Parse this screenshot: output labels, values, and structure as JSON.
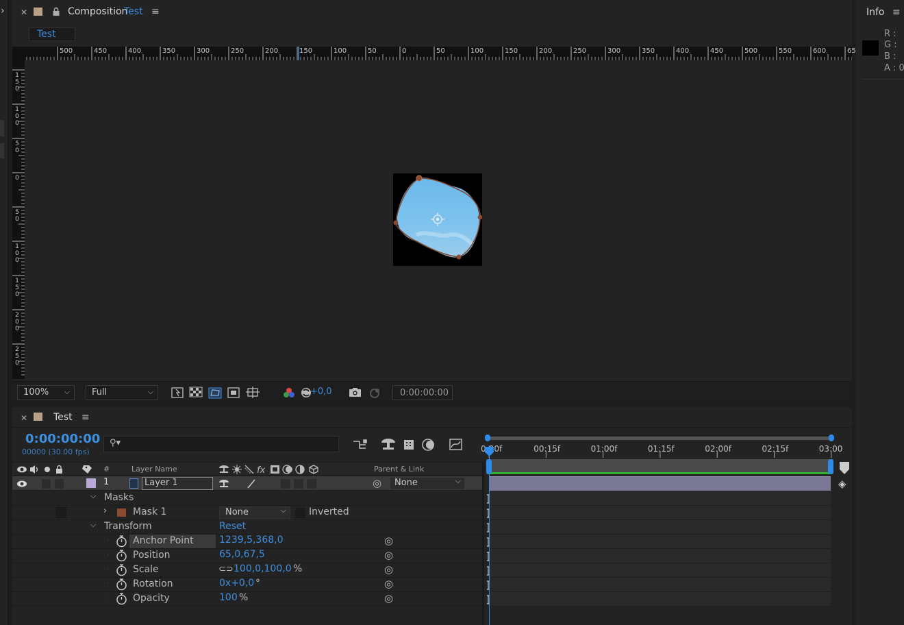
{
  "comp": {
    "tab_title": "Composition",
    "tab_name": "Test",
    "sub_tab": "Test",
    "zoom": "100%",
    "resolution": "Full",
    "exposure": "+0,0",
    "timecode": "0:00:00:00"
  },
  "ruler": {
    "h_labels": [
      "500",
      "450",
      "400",
      "350",
      "300",
      "250",
      "200",
      "150",
      "100",
      "50",
      "0",
      "50",
      "100",
      "150",
      "200",
      "250",
      "300",
      "350",
      "400",
      "450",
      "500",
      "550",
      "600",
      "650"
    ],
    "v_labels": [
      "150",
      "100",
      "50",
      "0",
      "50",
      "100",
      "150",
      "200",
      "250"
    ]
  },
  "info": {
    "title": "Info",
    "r": "R :",
    "g": "G :",
    "b": "B :",
    "a": "A : 0"
  },
  "timeline": {
    "tab_name": "Test",
    "current_time": "0:00:00:00",
    "frame_info": "00000 (30.00 fps)",
    "search_placeholder": "",
    "col_num": "#",
    "col_layer_name": "Layer Name",
    "col_parent": "Parent & Link",
    "time_labels": [
      "0:00f",
      "00:15f",
      "01:00f",
      "01:15f",
      "02:00f",
      "02:15f",
      "03:00"
    ],
    "layer": {
      "index": "1",
      "name": "Layer 1",
      "parent": "None",
      "label_color": "#b9a7d9"
    },
    "masks_label": "Masks",
    "mask": {
      "name": "Mask 1",
      "mode": "None",
      "inverted_label": "Inverted",
      "color": "#8a4a2e"
    },
    "transform_label": "Transform",
    "reset_label": "Reset",
    "props": [
      {
        "name": "Anchor Point",
        "value": "1239,5,368,0",
        "suffix": ""
      },
      {
        "name": "Position",
        "value": "65,0,67,5",
        "suffix": ""
      },
      {
        "name": "Scale",
        "value": "100,0,100,0",
        "suffix": "%"
      },
      {
        "name": "Rotation",
        "value": "0x+0,0",
        "suffix": "°"
      },
      {
        "name": "Opacity",
        "value": "100",
        "suffix": "%"
      }
    ]
  },
  "colors": {
    "accent": "#3d8fe0",
    "panel_bg": "#232323",
    "work_area_green": "#2fb12f"
  }
}
